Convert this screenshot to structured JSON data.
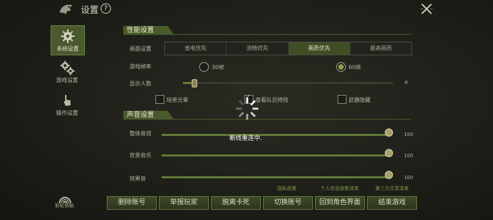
{
  "header": {
    "title": "设置",
    "help_symbol": "?"
  },
  "sidebar": {
    "items": [
      {
        "label": "系统设置",
        "icon": "gear-icon",
        "active": true
      },
      {
        "label": "游戏设置",
        "icon": "gears-icon",
        "active": false
      },
      {
        "label": "操作设置",
        "icon": "hand-pointer-icon",
        "active": false
      }
    ],
    "help_label": "彩虹帮助"
  },
  "performance": {
    "title": "性能设置",
    "quality_label": "画面设置",
    "quality_options": [
      "省电优先",
      "流畅优先",
      "画质优先",
      "最高画质"
    ],
    "quality_selected": "画质优先",
    "fps_label": "游戏帧率",
    "fps_options": [
      "30帧",
      "60帧"
    ],
    "fps_selected": "60帧",
    "players_label": "显示人数",
    "players_max": "8",
    "players_level": 0.05,
    "toggles": [
      {
        "label": "场景光晕",
        "checked": false
      },
      {
        "label": "查看队员特效",
        "checked": true
      },
      {
        "label": "武器隐藏",
        "checked": false
      }
    ]
  },
  "sound": {
    "title": "声音设置",
    "sliders": [
      {
        "label": "整体音效",
        "value": "100",
        "level": 1.0
      },
      {
        "label": "背景音乐",
        "value": "100",
        "level": 1.0
      },
      {
        "label": "效果音",
        "value": "100",
        "level": 1.0
      }
    ]
  },
  "links": [
    "隐私政策",
    "个人信息收集清单",
    "第三方共享清单"
  ],
  "buttons": [
    "删除账号",
    "举报玩家",
    "脱离卡死",
    "切换账号",
    "回到角色界面",
    "结束游戏"
  ],
  "overlay": {
    "status_text": "断线重连中."
  },
  "colors": {
    "accent": "#4a5a2e",
    "fill": "#647a35"
  }
}
